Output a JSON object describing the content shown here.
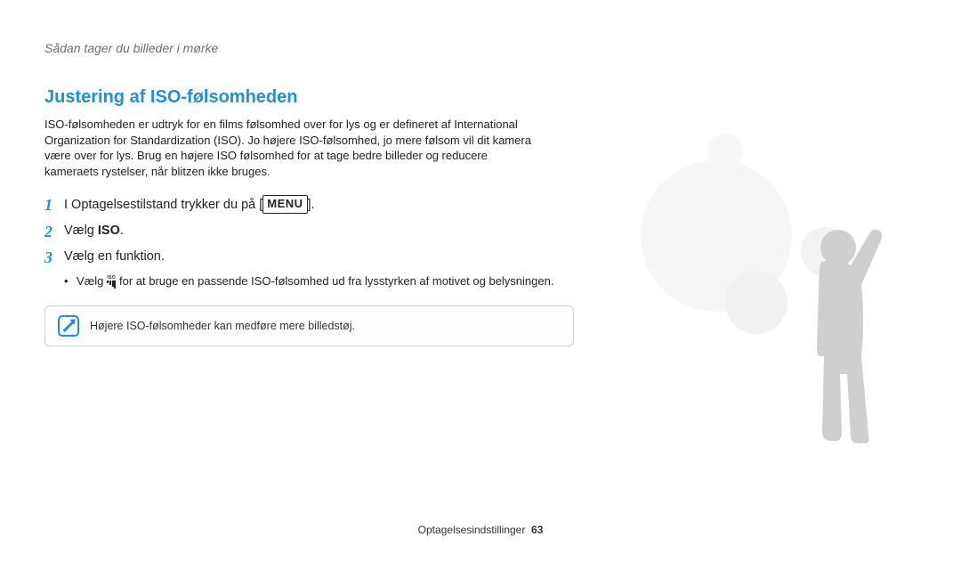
{
  "breadcrumb": "Sådan tager du billeder i mørke",
  "section_title": "Justering af ISO-følsomheden",
  "intro": "ISO-følsomheden er udtryk for en films følsomhed over for lys og er defineret af International Organization for Standardization (ISO). Jo højere ISO-følsomhed, jo mere følsom vil dit kamera være over for lys. Brug en højere ISO følsomhed for at tage bedre billeder og reducere kameraets rystelser, når blitzen ikke bruges.",
  "steps": {
    "s1": {
      "num": "1",
      "pre": "I Optagelsestilstand trykker du på [",
      "menu": "MENU",
      "post": "]."
    },
    "s2": {
      "num": "2",
      "pre": "Vælg ",
      "bold": "ISO",
      "post": "."
    },
    "s3": {
      "num": "3",
      "text": "Vælg en funktion."
    }
  },
  "bullet": {
    "pre": "Vælg ",
    "iso_label": "ISO",
    "post": " for at bruge en passende ISO-følsomhed ud fra lysstyrken af motivet og belysningen."
  },
  "note": "Højere ISO-følsomheder kan medføre mere billedstøj.",
  "footer": {
    "section": "Optagelsesindstillinger",
    "page": "63"
  }
}
